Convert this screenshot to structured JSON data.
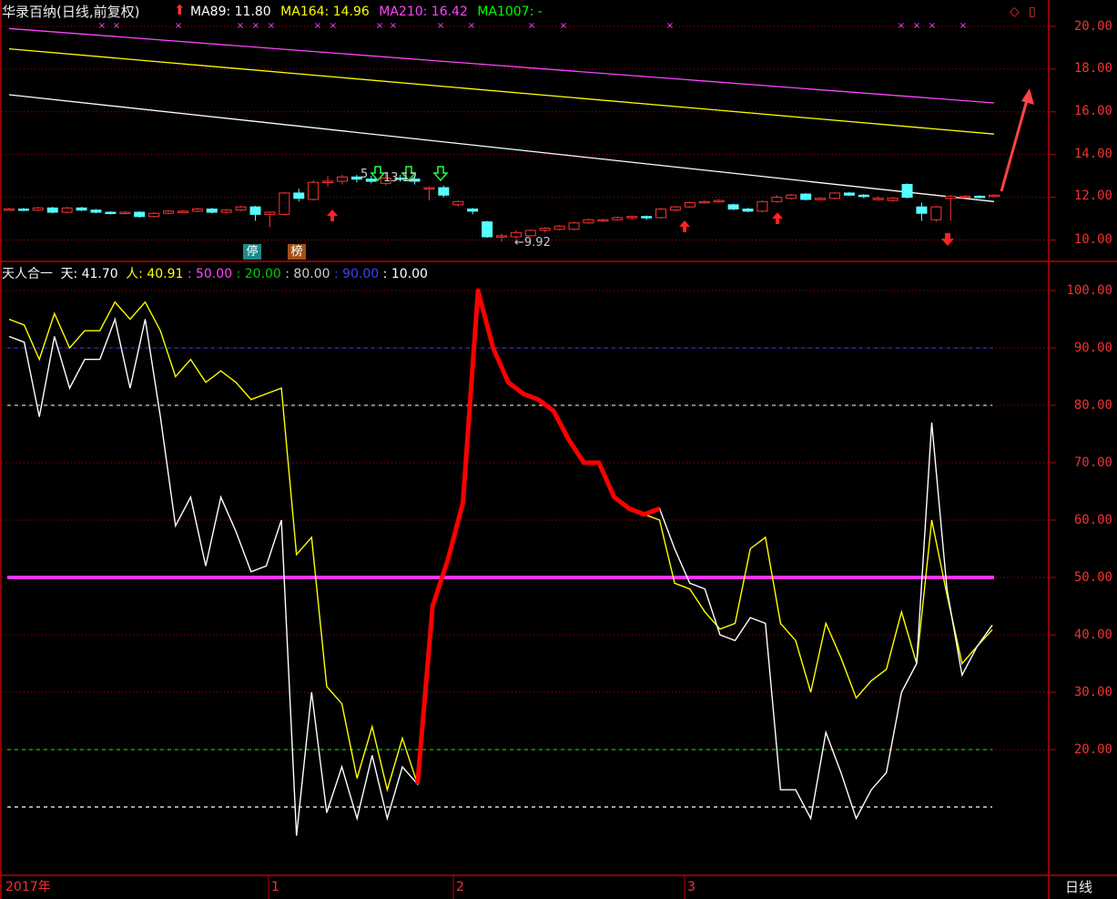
{
  "price_panel": {
    "title": "华录百纳(日线,前复权)",
    "indicators": [
      {
        "label": "MA89: 11.80",
        "color": "#ffffff"
      },
      {
        "label": "MA164: 14.96",
        "color": "#ffff00"
      },
      {
        "label": "MA210: 16.42",
        "color": "#ff44ff"
      },
      {
        "label": "MA1007: -",
        "color": "#00ff00"
      }
    ],
    "y_ticks": [
      "20.00",
      "18.00",
      "16.00",
      "14.00",
      "12.00",
      "10.00"
    ],
    "annotations": {
      "low": "←9.92",
      "high_a": "5",
      "high_b": "13.12",
      "tag_stop": "停",
      "tag_list": "榜"
    }
  },
  "indicator_panel": {
    "name": "天人合一",
    "values": [
      {
        "label": "天: 41.70",
        "color": "#ffffff"
      },
      {
        "label": "人: 40.91",
        "color": "#ffff00"
      },
      {
        "label": ": 50.00",
        "color": "#ff44ff"
      },
      {
        "label": ": 20.00",
        "color": "#00cc00"
      },
      {
        "label": ": 80.00",
        "color": "#cccccc"
      },
      {
        "label": ": 90.00",
        "color": "#3344ff"
      },
      {
        "label": ": 10.00",
        "color": "#ffffff"
      }
    ],
    "y_ticks": [
      "100.00",
      "90.00",
      "80.00",
      "70.00",
      "60.00",
      "50.00",
      "40.00",
      "30.00",
      "20.00"
    ]
  },
  "time_axis": {
    "year_label": "2017年",
    "months": [
      "1",
      "2",
      "3"
    ],
    "period": "日线"
  },
  "colors": {
    "axis": "#c00000",
    "ma89": "#ffffff",
    "ma164": "#ffff00",
    "ma210": "#ff44ff",
    "up": "#ff3333",
    "down": "#55ffff",
    "tian": "#ffffff",
    "ren": "#ffff00",
    "highlight": "#ff0000"
  },
  "chart_data": [
    {
      "type": "line",
      "title": "华录百纳(日线,前复权)",
      "ylim": [
        9,
        21
      ],
      "series": [
        {
          "name": "MA89",
          "values": [
            16.8,
            11.8
          ]
        },
        {
          "name": "MA164",
          "values": [
            18.95,
            14.96
          ]
        },
        {
          "name": "MA210",
          "values": [
            19.9,
            16.42
          ]
        }
      ],
      "candles": [
        [
          11.45,
          11.45,
          11.5,
          11.4
        ],
        [
          11.45,
          11.4,
          11.5,
          11.35
        ],
        [
          11.4,
          11.5,
          11.55,
          11.35
        ],
        [
          11.5,
          11.3,
          11.55,
          11.25
        ],
        [
          11.3,
          11.5,
          11.55,
          11.25
        ],
        [
          11.5,
          11.4,
          11.55,
          11.35
        ],
        [
          11.4,
          11.3,
          11.45,
          11.25
        ],
        [
          11.3,
          11.25,
          11.35,
          11.2
        ],
        [
          11.25,
          11.3,
          11.35,
          11.2
        ],
        [
          11.3,
          11.1,
          11.35,
          11.05
        ],
        [
          11.1,
          11.25,
          11.3,
          11.05
        ],
        [
          11.25,
          11.35,
          11.4,
          11.2
        ],
        [
          11.35,
          11.35,
          11.4,
          11.3
        ],
        [
          11.35,
          11.45,
          11.5,
          11.3
        ],
        [
          11.45,
          11.3,
          11.5,
          11.25
        ],
        [
          11.3,
          11.4,
          11.45,
          11.25
        ],
        [
          11.4,
          11.55,
          11.6,
          11.35
        ],
        [
          11.55,
          11.2,
          11.6,
          10.9
        ],
        [
          11.2,
          11.3,
          11.35,
          10.6
        ],
        [
          11.2,
          12.2,
          12.25,
          11.15
        ],
        [
          12.2,
          11.95,
          12.4,
          11.8
        ],
        [
          11.9,
          12.7,
          12.8,
          11.85
        ],
        [
          12.7,
          12.75,
          13.0,
          12.5
        ],
        [
          12.75,
          12.95,
          13.05,
          12.6
        ],
        [
          12.95,
          12.85,
          13.05,
          12.7
        ],
        [
          12.85,
          12.75,
          13.0,
          12.65
        ],
        [
          12.65,
          12.9,
          13.12,
          12.55
        ],
        [
          12.9,
          12.85,
          13.05,
          12.75
        ],
        [
          12.85,
          12.75,
          13.0,
          12.6
        ],
        [
          12.45,
          12.45,
          12.5,
          11.85
        ],
        [
          12.45,
          12.1,
          12.55,
          12.0
        ],
        [
          11.65,
          11.8,
          11.85,
          11.55
        ],
        [
          11.45,
          11.35,
          11.5,
          11.2
        ],
        [
          10.85,
          10.15,
          10.9,
          10.1
        ],
        [
          10.15,
          10.2,
          10.3,
          9.92
        ],
        [
          10.15,
          10.35,
          10.45,
          10.05
        ],
        [
          10.2,
          10.45,
          10.5,
          10.15
        ],
        [
          10.45,
          10.55,
          10.6,
          10.35
        ],
        [
          10.5,
          10.65,
          10.7,
          10.45
        ],
        [
          10.5,
          10.8,
          10.85,
          10.45
        ],
        [
          10.8,
          10.95,
          11.0,
          10.75
        ],
        [
          10.95,
          10.95,
          11.0,
          10.85
        ],
        [
          10.95,
          11.05,
          11.1,
          10.9
        ],
        [
          11.05,
          11.1,
          11.15,
          10.95
        ],
        [
          11.1,
          11.05,
          11.15,
          10.95
        ],
        [
          11.05,
          11.45,
          11.5,
          11.0
        ],
        [
          11.4,
          11.55,
          11.6,
          11.35
        ],
        [
          11.55,
          11.75,
          11.8,
          11.5
        ],
        [
          11.75,
          11.8,
          11.85,
          11.7
        ],
        [
          11.8,
          11.85,
          11.9,
          11.75
        ],
        [
          11.65,
          11.45,
          11.7,
          11.4
        ],
        [
          11.45,
          11.35,
          11.5,
          11.3
        ],
        [
          11.35,
          11.8,
          11.85,
          11.3
        ],
        [
          11.8,
          12.0,
          12.1,
          11.75
        ],
        [
          11.95,
          12.1,
          12.15,
          11.9
        ],
        [
          12.15,
          11.9,
          12.2,
          11.85
        ],
        [
          11.9,
          11.95,
          12.0,
          11.85
        ],
        [
          11.95,
          12.2,
          12.25,
          11.9
        ],
        [
          12.2,
          12.1,
          12.25,
          12.05
        ],
        [
          12.1,
          12.05,
          12.15,
          11.95
        ],
        [
          11.95,
          11.95,
          12.05,
          11.85
        ],
        [
          11.85,
          11.95,
          12.0,
          11.8
        ],
        [
          12.6,
          12.0,
          12.65,
          11.95
        ],
        [
          11.55,
          11.25,
          11.75,
          10.9
        ],
        [
          10.95,
          11.55,
          11.6,
          10.85
        ],
        [
          11.95,
          12.05,
          12.1,
          10.9
        ],
        [
          12.05,
          12.05,
          12.1,
          12.0
        ],
        [
          12.05,
          12.0,
          12.1,
          11.95
        ],
        [
          12.05,
          12.1,
          12.15,
          12.0
        ]
      ]
    },
    {
      "type": "line",
      "title": "天人合一",
      "ylim": [
        5,
        102
      ],
      "series": [
        {
          "name": "天",
          "values": [
            92,
            91,
            78,
            92,
            83,
            88,
            88,
            95,
            83,
            95,
            78,
            59,
            64,
            52,
            64,
            58,
            51,
            52,
            60,
            5,
            30,
            9,
            17,
            8,
            19,
            8,
            17,
            14,
            45,
            53,
            63,
            100,
            90,
            84,
            82,
            81,
            79,
            74,
            70,
            70,
            64,
            62,
            61,
            62,
            55,
            49,
            48,
            40,
            39,
            43,
            42,
            13,
            13,
            8,
            23,
            16,
            8,
            13,
            16,
            30,
            35,
            77,
            48,
            33,
            38,
            41.7
          ]
        },
        {
          "name": "人",
          "values": [
            95,
            94,
            88,
            96,
            90,
            93,
            93,
            98,
            95,
            98,
            93,
            85,
            88,
            84,
            86,
            84,
            81,
            82,
            83,
            54,
            57,
            31,
            28,
            15,
            24,
            13,
            22,
            14,
            45,
            53,
            63,
            100,
            90,
            84,
            82,
            81,
            79,
            74,
            70,
            70,
            64,
            62,
            61,
            60,
            49,
            48,
            44,
            41,
            42,
            55,
            57,
            42,
            39,
            30,
            42,
            36,
            29,
            32,
            34,
            44,
            35,
            60,
            47,
            35,
            38,
            40.91
          ]
        }
      ],
      "highlight_range": [
        27,
        43
      ],
      "reference_lines": [
        90,
        80,
        50,
        20,
        10
      ]
    }
  ]
}
